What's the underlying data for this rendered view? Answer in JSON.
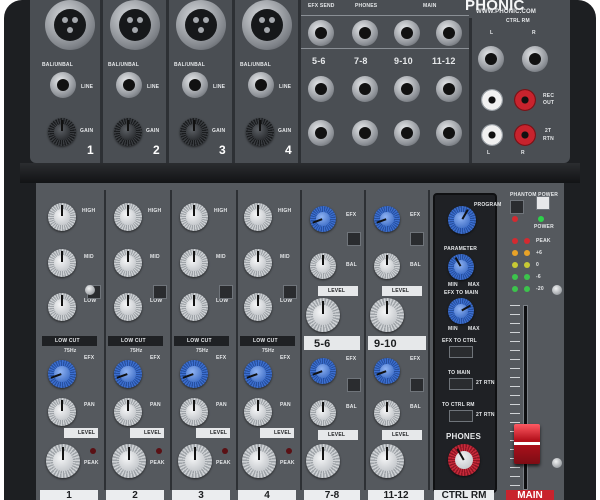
{
  "brand": {
    "name": "PHONIC",
    "url": "WWW.PHONIC.COM"
  },
  "top": {
    "input_labels": [
      "BAL/UNBAL",
      "LINE",
      "GAIN"
    ],
    "input_numbers": [
      "1",
      "2",
      "3",
      "4"
    ],
    "section_labels": [
      "EFX SEND",
      "PHONES",
      "MAIN",
      "CTRL RM"
    ],
    "stereo_labels": [
      "5-6",
      "7-8",
      "9-10",
      "11-12"
    ],
    "rec_labels": [
      "REC",
      "OUT",
      "2T",
      "RTN"
    ],
    "lr": [
      "L",
      "R"
    ]
  },
  "mono_strip": {
    "eq_labels": [
      "HIGH",
      "MID",
      "LOW"
    ],
    "low_cut": "LOW CUT",
    "hz": "75Hz",
    "efx": "EFX",
    "pan": "PAN",
    "level": "LEVEL",
    "peak": "PEAK"
  },
  "stereo_strip": {
    "efx": "EFX",
    "bal": "BAL",
    "level": "LEVEL",
    "names": [
      "5-6",
      "9-10"
    ]
  },
  "master": {
    "program": "PROGRAM",
    "parameter": "PARAMETER",
    "efx_to_main": "EFX TO MAIN",
    "min": "MIN",
    "max": "MAX",
    "efx_to_ctrl": "EFX TO CTRL",
    "to_main": "TO MAIN",
    "to_ctrl_rm": "TO CTRL RM",
    "two_trk": "2T RTN",
    "phones": "PHONES",
    "phantom": "PHANTOM POWER",
    "power": "POWER",
    "meter_labels": [
      "PEAK",
      "+6",
      "0",
      "-6",
      "-20"
    ]
  },
  "bottom_labels": [
    "1",
    "2",
    "3",
    "4",
    "7-8",
    "11-12",
    "CTRL RM",
    "MAIN"
  ],
  "colors": {
    "accent_red": "#c8232d",
    "knob_blue": "#2d5fbd",
    "panel": "#55595e"
  }
}
